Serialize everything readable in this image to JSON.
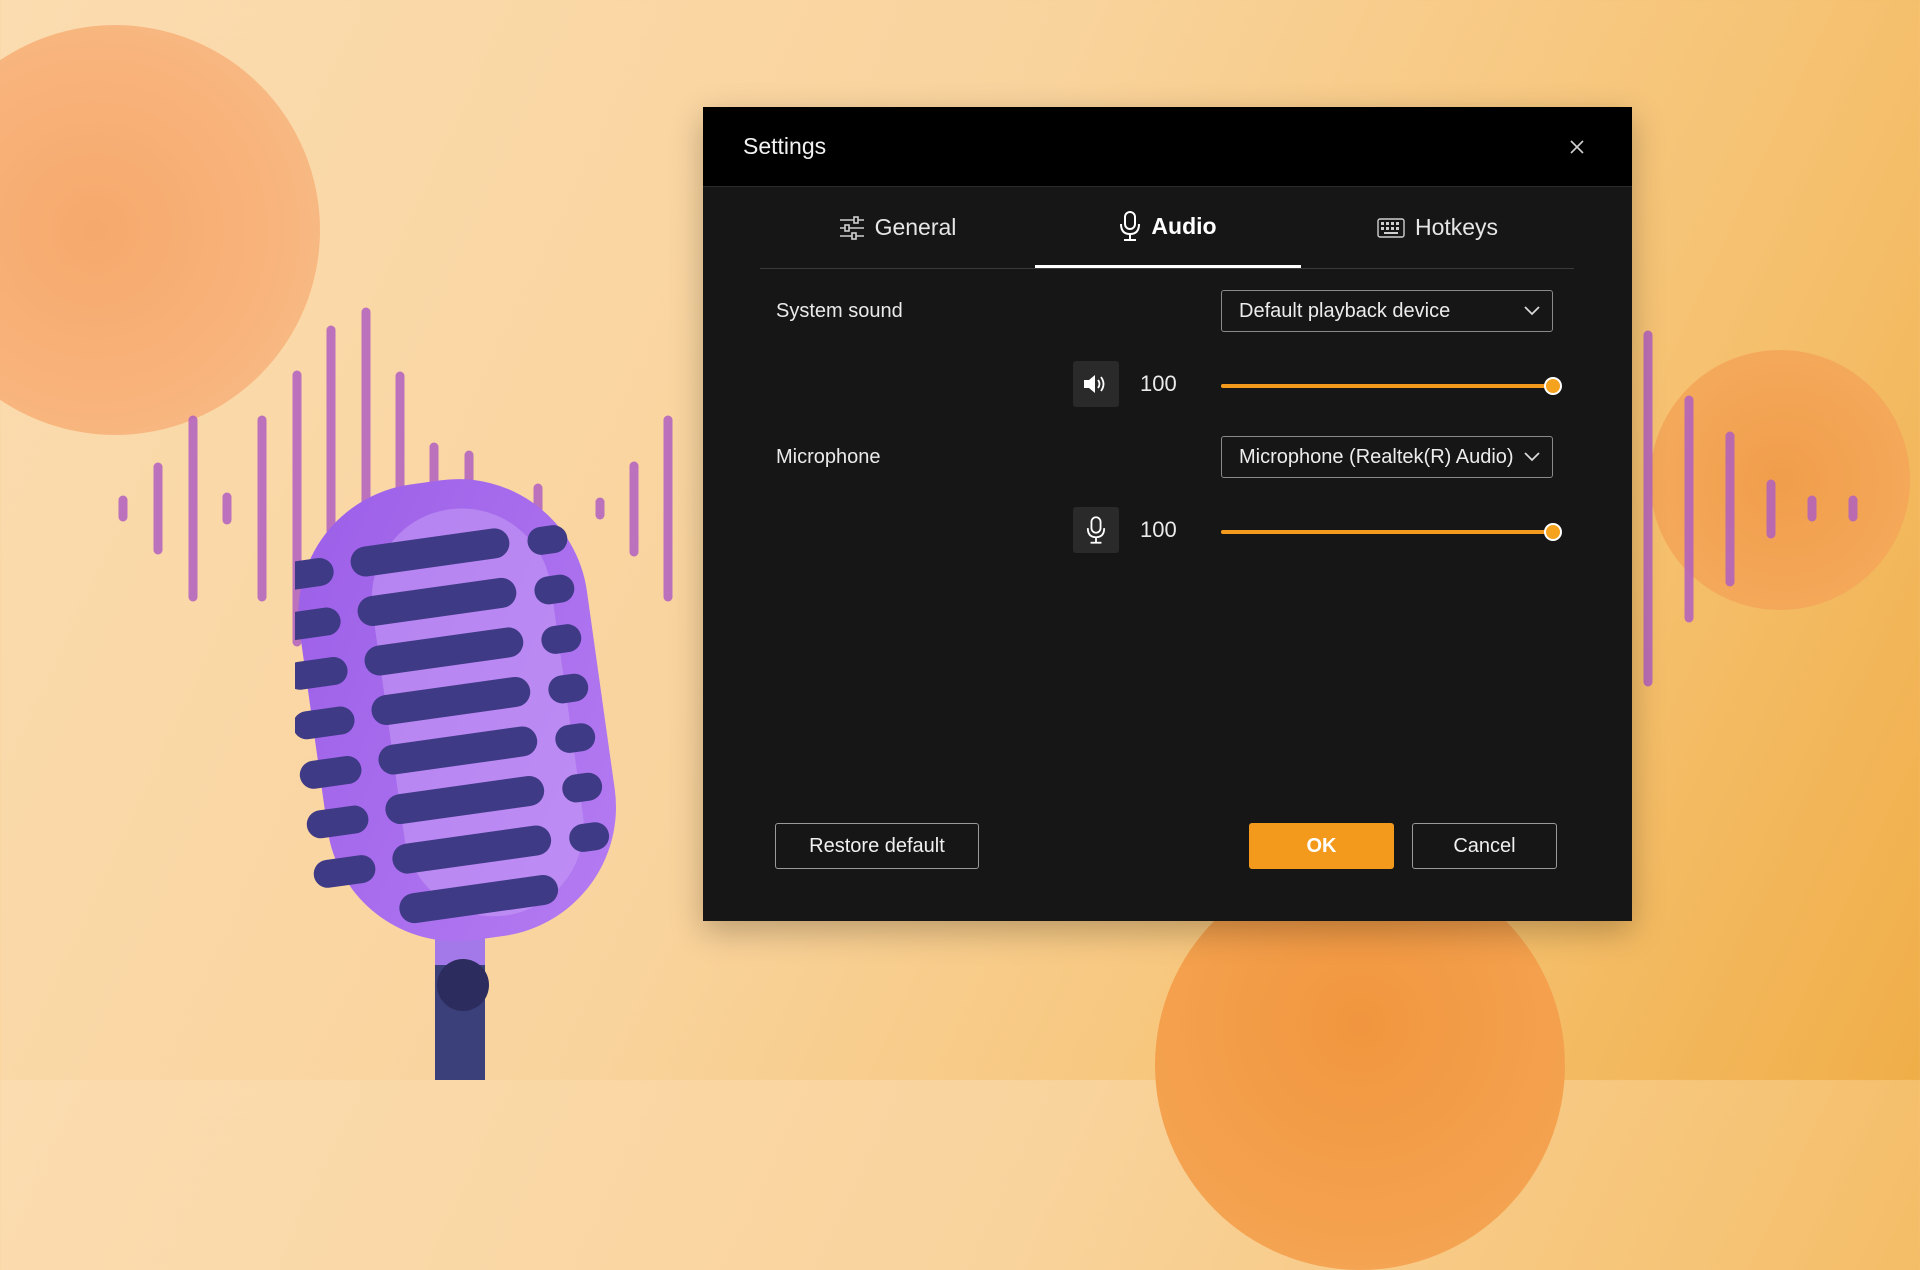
{
  "window": {
    "title": "Settings"
  },
  "tabs": [
    {
      "label": "General",
      "icon": "sliders-icon"
    },
    {
      "label": "Audio",
      "icon": "microphone-icon",
      "active": true
    },
    {
      "label": "Hotkeys",
      "icon": "keyboard-icon"
    }
  ],
  "system_sound": {
    "label": "System sound",
    "device": "Default playback device",
    "volume": "100",
    "volume_fraction": 1.0,
    "icon": "speaker-icon"
  },
  "microphone": {
    "label": "Microphone",
    "device": "Microphone (Realtek(R) Audio)",
    "volume": "100",
    "volume_fraction": 1.0,
    "icon": "microphone-icon"
  },
  "buttons": {
    "restore_default": "Restore default",
    "ok": "OK",
    "cancel": "Cancel"
  },
  "colors": {
    "accent": "#f39a1d",
    "dialog_bg": "#161616",
    "titlebar_bg": "#000000"
  }
}
